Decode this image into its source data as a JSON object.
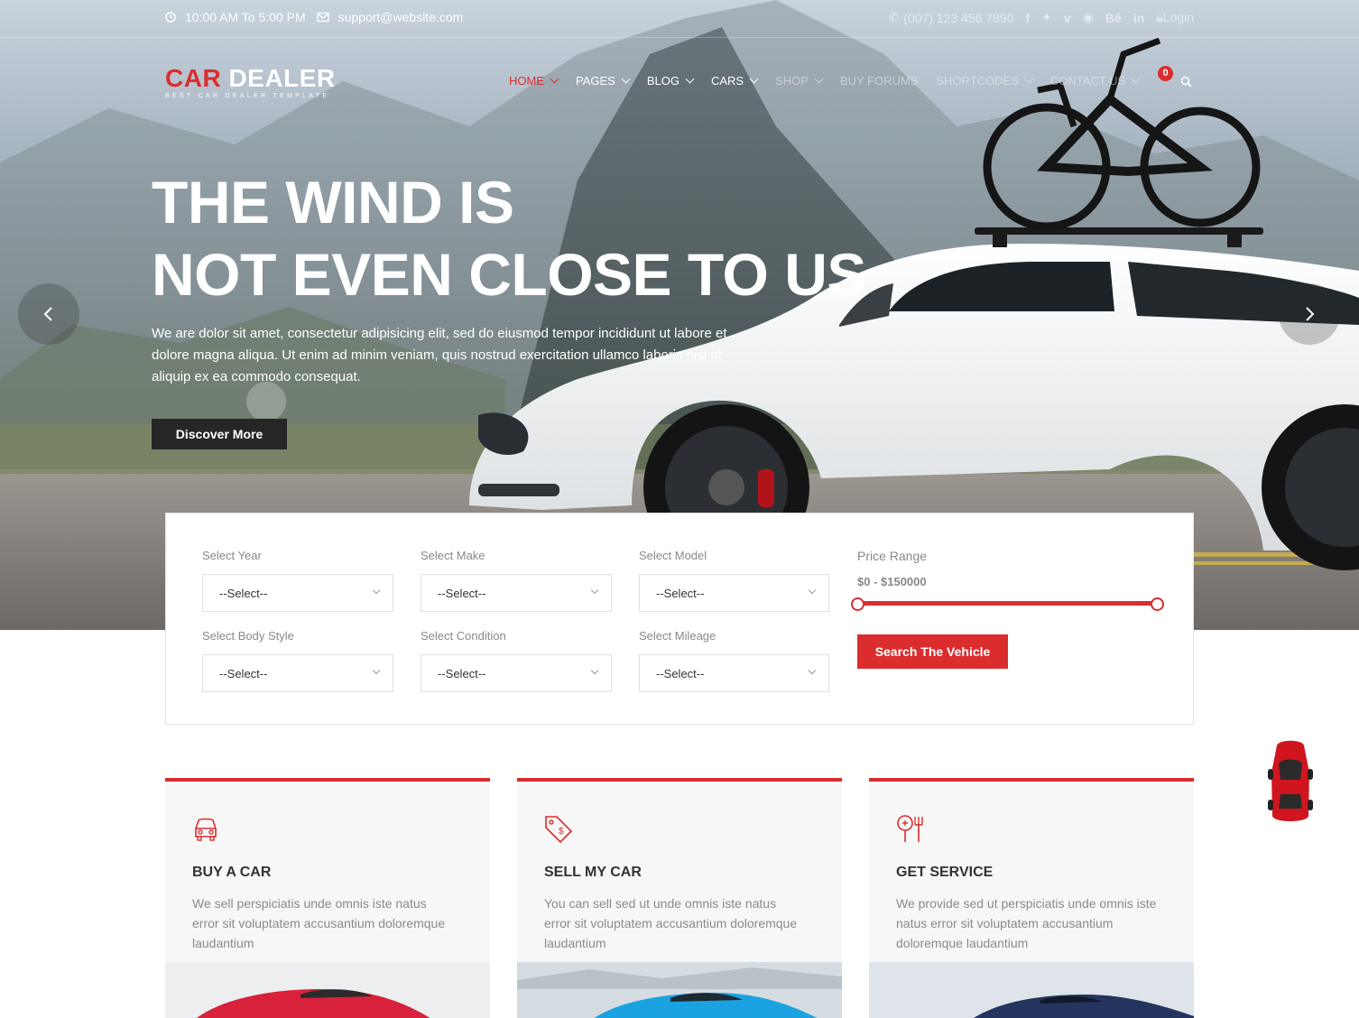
{
  "topbar": {
    "hours": "10:00 AM To 5:00 PM",
    "email": "support@website.com",
    "phone": "(007) 123 456 7890",
    "social_icons": [
      "facebook-icon",
      "twitter-icon",
      "vimeo-icon",
      "pinterest-icon",
      "behance-icon",
      "linkedin-icon"
    ],
    "login": "Login"
  },
  "logo": {
    "part1": "CAR",
    "part2": "DEALER",
    "tagline": "BEST CAR DEALER TEMPLATE"
  },
  "nav": {
    "items": [
      {
        "label": "HOME"
      },
      {
        "label": "PAGES"
      },
      {
        "label": "BLOG"
      },
      {
        "label": "CARS"
      },
      {
        "label": "SHOP"
      },
      {
        "label": "BUY FORUMS"
      },
      {
        "label": "SHORTCODES"
      },
      {
        "label": "CONTACT US"
      }
    ],
    "cart_count": "0"
  },
  "hero": {
    "title_line1": "THE WIND IS",
    "title_line2": "NOT EVEN CLOSE TO US",
    "text": "We are dolor sit amet, consectetur adipisicing elit, sed do eiusmod tempor incididunt ut labore et dolore magna aliqua. Ut enim ad minim veniam, quis nostrud exercitation ullamco laboris nisi ut aliquip ex ea commodo consequat.",
    "button": "Discover More"
  },
  "search": {
    "fields": [
      {
        "label": "Select Year",
        "value": "--Select--"
      },
      {
        "label": "Select Make",
        "value": "--Select--"
      },
      {
        "label": "Select Model",
        "value": "--Select--"
      },
      {
        "label": "Select Body Style",
        "value": "--Select--"
      },
      {
        "label": "Select Condition",
        "value": "--Select--"
      },
      {
        "label": "Select Mileage",
        "value": "--Select--"
      }
    ],
    "price_label": "Price Range",
    "price_value": "$0 - $150000",
    "price_range": [
      0,
      150000
    ],
    "button": "Search The Vehicle"
  },
  "services": [
    {
      "title": "BUY A CAR",
      "text": "We sell perspiciatis unde omnis iste natus error sit voluptatem accusantium doloremque laudantium",
      "icon": "car-icon"
    },
    {
      "title": "SELL MY CAR",
      "text": "You can sell sed ut unde omnis iste natus error sit voluptatem accusantium doloremque laudantium",
      "icon": "price-tag-icon"
    },
    {
      "title": "GET SERVICE",
      "text": "We provide sed ut perspiciatis unde omnis iste natus error sit voluptatem accusantium doloremque laudantium",
      "icon": "service-tools-icon"
    }
  ],
  "colors": {
    "accent": "#db2d2e",
    "dark_button": "#262626"
  }
}
